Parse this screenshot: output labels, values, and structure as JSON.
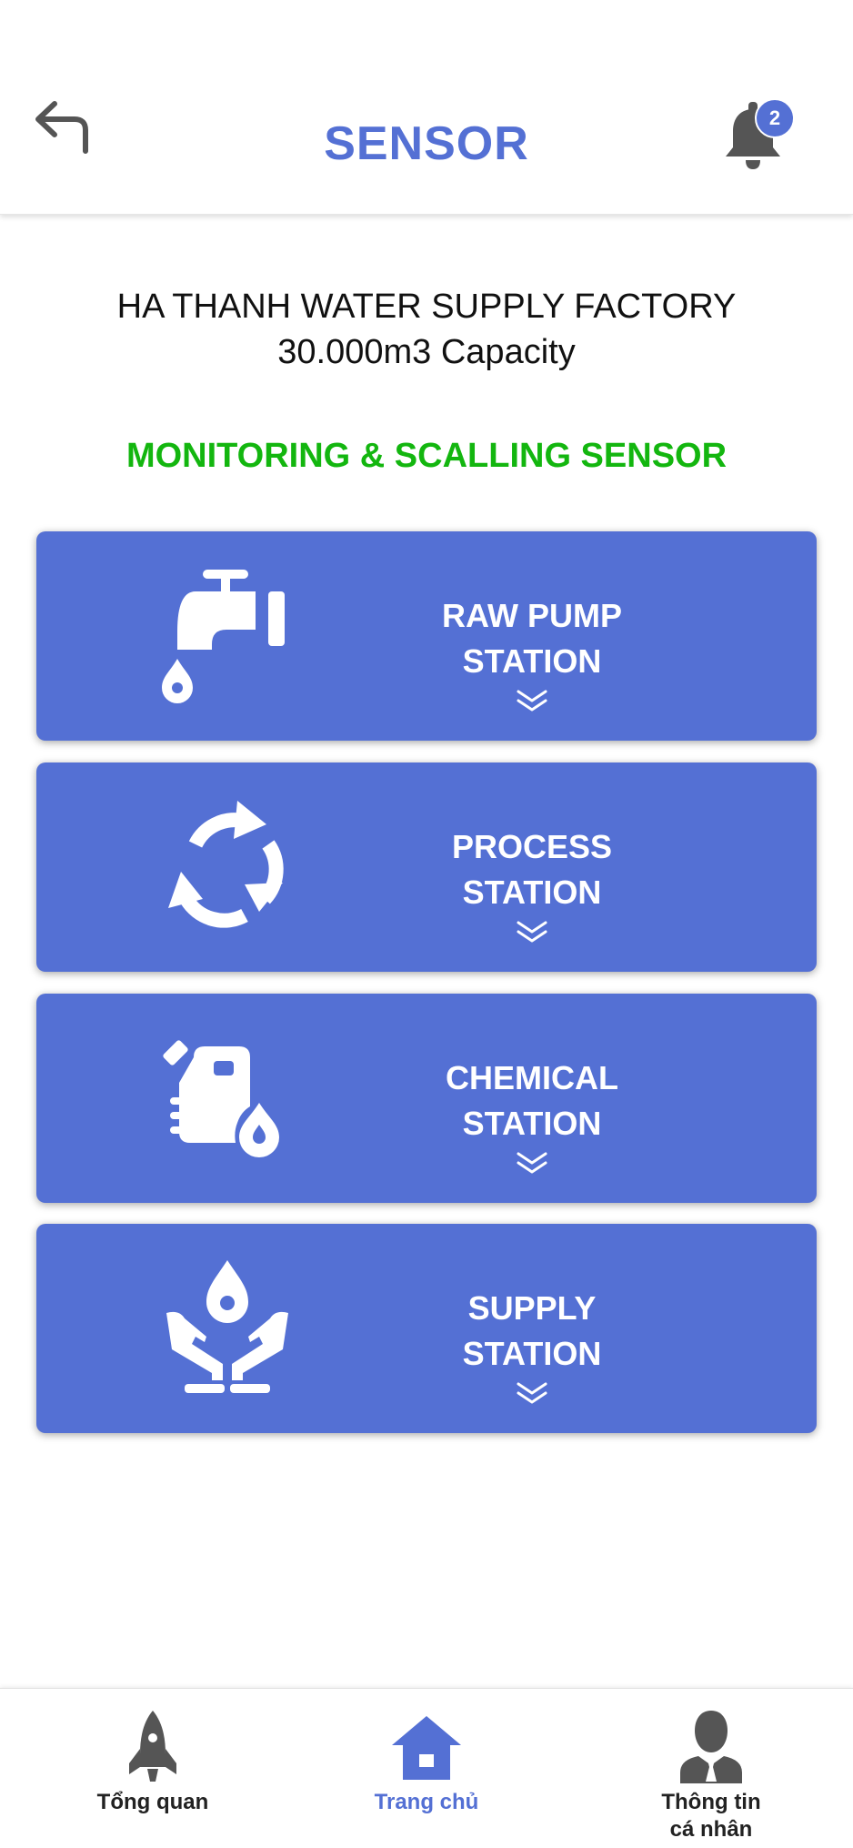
{
  "header": {
    "title": "SENSOR",
    "notification_count": "2",
    "back_icon": "back-arrow-icon",
    "bell_icon": "bell-icon"
  },
  "factory": {
    "name": "HA THANH WATER SUPPLY FACTORY",
    "capacity": "30.000m3 Capacity"
  },
  "section_title": "MONITORING & SCALLING SENSOR",
  "stations": [
    {
      "line1": "RAW PUMP",
      "line2": "STATION",
      "icon": "water-tap-icon"
    },
    {
      "line1": "PROCESS",
      "line2": "STATION",
      "icon": "recycle-icon"
    },
    {
      "line1": "CHEMICAL",
      "line2": "STATION",
      "icon": "chemical-can-icon"
    },
    {
      "line1": "SUPPLY",
      "line2": "STATION",
      "icon": "hands-water-drop-icon"
    }
  ],
  "bottom_nav": [
    {
      "label": "Tổng quan",
      "icon": "rocket-icon",
      "active": false
    },
    {
      "label": "Trang chủ",
      "icon": "home-icon",
      "active": true
    },
    {
      "label_line1": "Thông tin",
      "label_line2": "cá nhân",
      "icon": "user-icon",
      "active": false
    }
  ],
  "colors": {
    "primary": "#5470d4",
    "section_title": "#13b60f",
    "nav_inactive": "#222222",
    "icon_gray": "#555555"
  }
}
